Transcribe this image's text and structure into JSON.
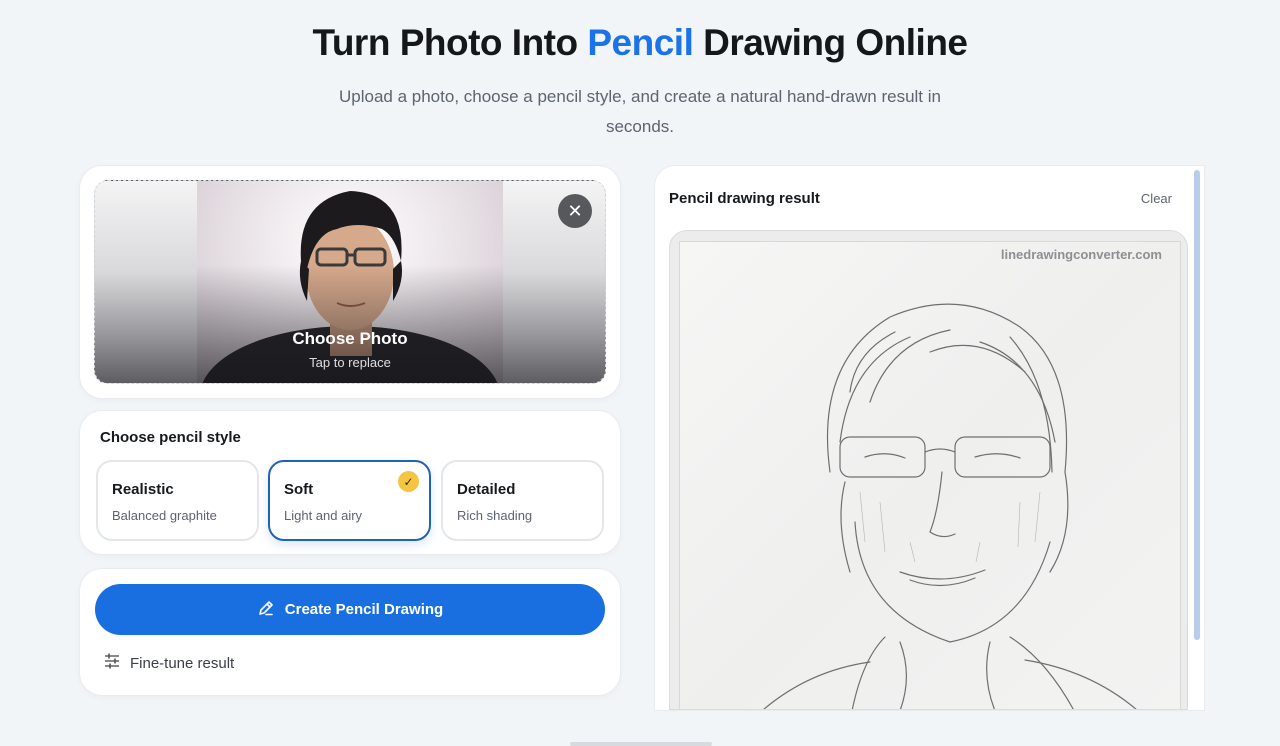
{
  "header": {
    "title_before": "Turn Photo Into",
    "title_accent": "Pencil",
    "title_after": "Drawing Online",
    "subtitle": "Upload a photo, choose a pencil style, and create a natural hand-drawn result in seconds."
  },
  "upload": {
    "label": "Choose Photo",
    "hint": "Tap to replace",
    "remove_glyph": "✕"
  },
  "styles": {
    "heading": "Choose pencil style",
    "options": [
      {
        "name": "Realistic",
        "desc": "Balanced graphite",
        "selected": false
      },
      {
        "name": "Soft",
        "desc": "Light and airy",
        "selected": true
      },
      {
        "name": "Detailed",
        "desc": "Rich shading",
        "selected": false
      }
    ],
    "check_glyph": "✓"
  },
  "actions": {
    "create_label": "Create Pencil Drawing",
    "finetune_label": "Fine-tune result"
  },
  "result": {
    "title": "Pencil drawing result",
    "clear_label": "Clear",
    "watermark": "linedrawingconverter.com"
  },
  "icons": {
    "remove": "close-icon",
    "check": "check-icon",
    "create": "pencil-icon",
    "finetune": "sliders-icon"
  },
  "colors": {
    "accent": "#1a73e8",
    "button": "#1a6fe0",
    "selected_border": "#1d63b8",
    "check_badge": "#f5c542"
  }
}
